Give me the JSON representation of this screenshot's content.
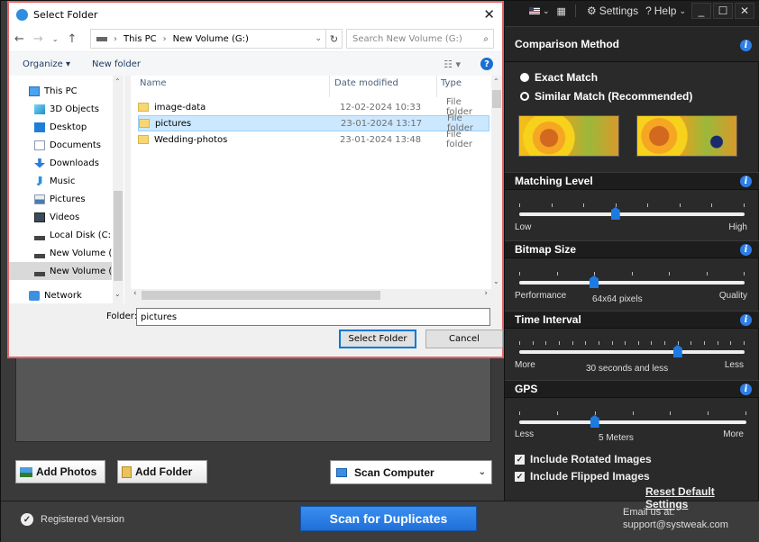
{
  "dialog": {
    "title": "Select Folder",
    "breadcrumb": [
      "This PC",
      "New Volume (G:)"
    ],
    "search_placeholder": "Search New Volume (G:)",
    "organize_label": "Organize ▾",
    "new_folder_label": "New folder",
    "nav_items": [
      {
        "label": "This PC",
        "icon": "computer-icon"
      },
      {
        "label": "3D Objects",
        "icon": "cube-icon"
      },
      {
        "label": "Desktop",
        "icon": "desktop-icon"
      },
      {
        "label": "Documents",
        "icon": "documents-icon"
      },
      {
        "label": "Downloads",
        "icon": "download-icon"
      },
      {
        "label": "Music",
        "icon": "music-icon"
      },
      {
        "label": "Pictures",
        "icon": "pictures-icon"
      },
      {
        "label": "Videos",
        "icon": "videos-icon"
      },
      {
        "label": "Local Disk (C:)",
        "icon": "drive-icon"
      },
      {
        "label": "New Volume (E:)",
        "icon": "drive-icon"
      },
      {
        "label": "New Volume (G:)",
        "icon": "drive-icon",
        "selected": true
      },
      {
        "label": "Network",
        "icon": "network-icon"
      }
    ],
    "columns": [
      "Name",
      "Date modified",
      "Type"
    ],
    "files": [
      {
        "name": "image-data",
        "date": "12-02-2024 10:33",
        "type": "File folder"
      },
      {
        "name": "pictures",
        "date": "23-01-2024 13:17",
        "type": "File folder",
        "selected": true
      },
      {
        "name": "Wedding-photos",
        "date": "23-01-2024 13:48",
        "type": "File folder"
      }
    ],
    "folder_label": "Folder:",
    "folder_value": "pictures",
    "select_button": "Select Folder",
    "cancel_button": "Cancel"
  },
  "main": {
    "add_photos": "Add Photos",
    "add_folder": "Add Folder",
    "scan_mode": "Scan Computer",
    "scan_button": "Scan for Duplicates",
    "registered": "Registered Version",
    "email_label": "Email us at:",
    "email": "support@systweak.com"
  },
  "topbar": {
    "settings": "Settings",
    "help": "Help"
  },
  "settings": {
    "comparison_title": "Comparison Method",
    "exact_match": "Exact Match",
    "similar_match": "Similar Match (Recommended)",
    "selected_method": "Exact Match",
    "matching_level": {
      "title": "Matching Level",
      "low": "Low",
      "high": "High",
      "ticks": 8,
      "position": 3
    },
    "bitmap_size": {
      "title": "Bitmap Size",
      "low": "Performance",
      "high": "Quality",
      "value": "64x64 pixels",
      "ticks": 7,
      "position": 2
    },
    "time_interval": {
      "title": "Time Interval",
      "low": "More",
      "high": "Less",
      "value": "30 seconds and less",
      "ticks": 18,
      "position": 12
    },
    "gps": {
      "title": "GPS",
      "low": "Less",
      "high": "More",
      "value": "5 Meters",
      "ticks": 7,
      "position": 2
    },
    "include_rotated": "Include Rotated Images",
    "include_flipped": "Include Flipped Images",
    "rotated_checked": true,
    "flipped_checked": true,
    "reset": "Reset Default Settings"
  },
  "colors": {
    "accent": "#1e7ae0",
    "dialog_border": "#e06666",
    "selection": "#cce8ff"
  }
}
